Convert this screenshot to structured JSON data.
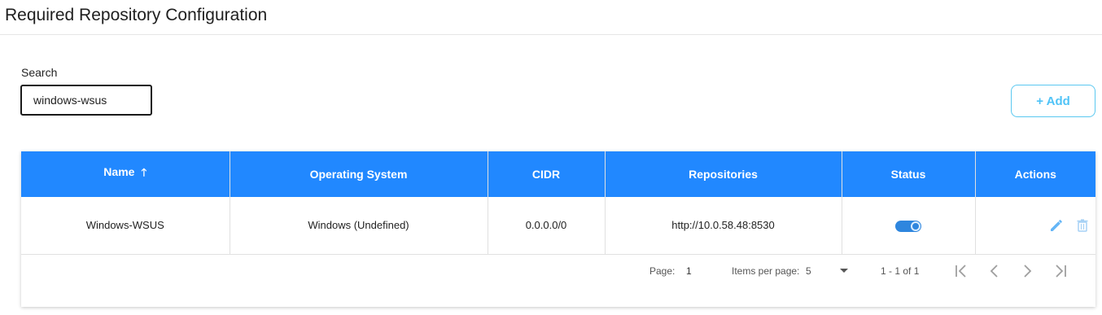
{
  "page": {
    "title": "Required Repository Configuration"
  },
  "search": {
    "label": "Search",
    "value": "windows-wsus"
  },
  "toolbar": {
    "add_label": "+ Add"
  },
  "table": {
    "columns": [
      "Name",
      "Operating System",
      "CIDR",
      "Repositories",
      "Status",
      "Actions"
    ],
    "sort": {
      "column": "Name",
      "direction": "ascending",
      "icon": "arrow-up-icon"
    },
    "rows": [
      {
        "name": "Windows-WSUS",
        "os": "Windows (Undefined)",
        "cidr": "0.0.0.0/0",
        "repositories": "http://10.0.58.48:8530",
        "status_enabled": true,
        "actions": [
          "edit-icon",
          "delete-icon"
        ]
      }
    ]
  },
  "paginator": {
    "page_label": "Page:",
    "page_value": "1",
    "items_per_page_label": "Items per page:",
    "items_per_page_value": "5",
    "range": "1 - 1 of 1",
    "buttons": [
      "first-page-icon",
      "prev-page-icon",
      "next-page-icon",
      "last-page-icon"
    ]
  },
  "colors": {
    "header_bg": "#2188ff",
    "accent": "#4fc3f7",
    "toggle": "#2e86de",
    "icon": "#64b5f6"
  }
}
